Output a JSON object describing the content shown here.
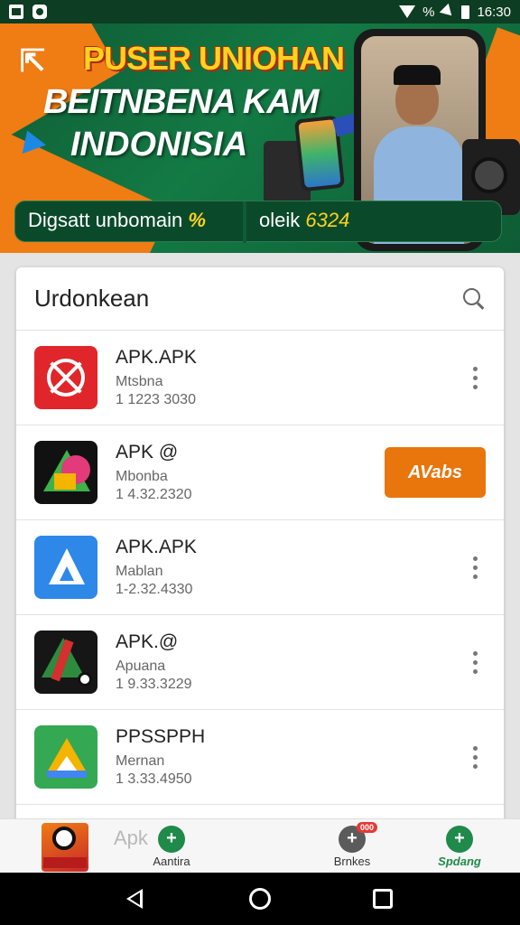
{
  "status_bar": {
    "time": "16:30",
    "battery_glyph": "%"
  },
  "banner": {
    "headline": "PUSER UNIOHAN",
    "subtitle_line1": "BEITNBENA KAM",
    "subtitle_line2": "INDONISIA",
    "pill_left_text": "Digsatt unbomain",
    "pill_left_pct": "%",
    "pill_right_text": "oleik",
    "pill_right_num": "6324"
  },
  "list": {
    "title": "Urdonkean",
    "apps": [
      {
        "name": "APK.APK",
        "subtitle": "Mtsbna",
        "version": "1 1223 3030",
        "icon": "red-x-icon",
        "has_action": false
      },
      {
        "name": "APK @",
        "subtitle": "Mbonba",
        "version": "1 4.32.2320",
        "icon": "colorful-triangle-icon",
        "has_action": true,
        "action_label": "AVabs"
      },
      {
        "name": "APK.APK",
        "subtitle": "Mablan",
        "version": "1-2.32.4330",
        "icon": "blue-a-icon",
        "has_action": false
      },
      {
        "name": "APK.@",
        "subtitle": "Apuana",
        "version": "1 9.33.3229",
        "icon": "dark-green-red-icon",
        "has_action": false
      },
      {
        "name": "PPSSPPH",
        "subtitle": "Mernan",
        "version": "1 3.33.4950",
        "icon": "green-drive-icon",
        "has_action": false
      }
    ]
  },
  "bottom_nav": {
    "ghost_text": "Apk",
    "items": [
      {
        "label": "Aantira",
        "badge": ""
      },
      {
        "label": "Brnkes",
        "badge": "000"
      },
      {
        "label": "Spdang",
        "badge": ""
      }
    ]
  },
  "colors": {
    "accent_orange": "#e8760c",
    "banner_green": "#137a44",
    "nav_green": "#1f8a4a"
  }
}
